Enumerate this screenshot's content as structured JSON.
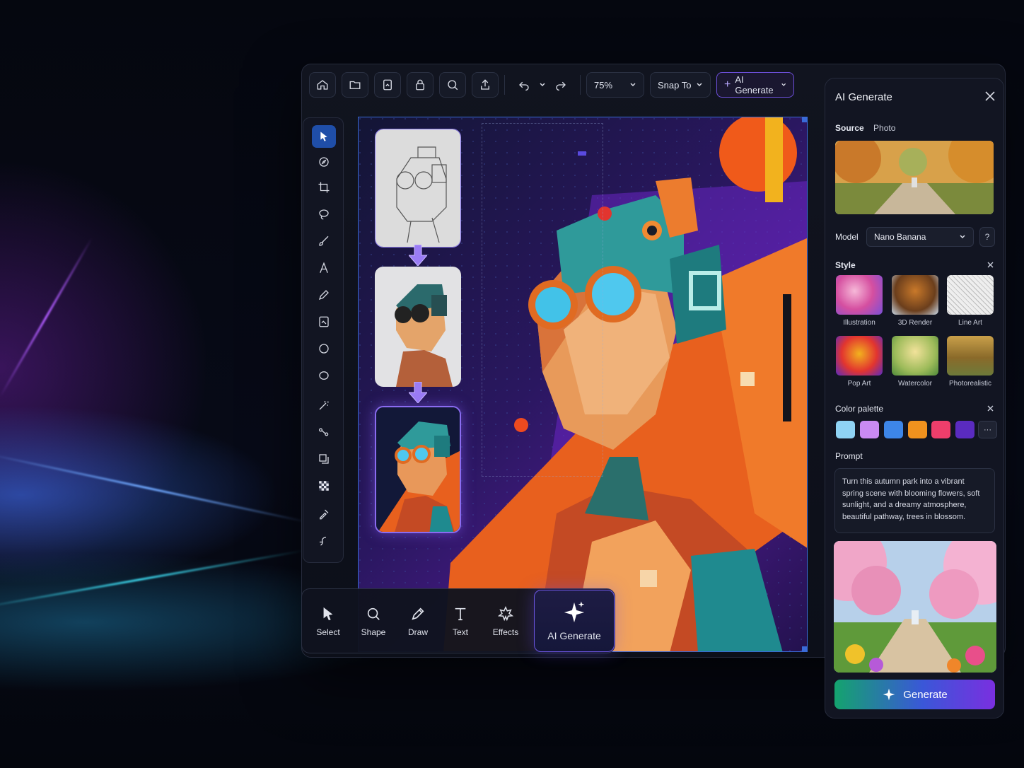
{
  "toolbar": {
    "zoom": "75%",
    "snap": "Snap To",
    "ai_generate": "AI Generate"
  },
  "panel": {
    "title": "AI Generate",
    "source_label": "Source",
    "source_value": "Photo",
    "model_label": "Model",
    "model_value": "Nano Banana",
    "model_help": "?",
    "style_label": "Style",
    "styles": [
      "Illustration",
      "3D Render",
      "Line Art",
      "Pop Art",
      "Watercolor",
      "Photorealistic"
    ],
    "palette_label": "Color palette",
    "palette_colors": [
      "#8fd3f4",
      "#c98af2",
      "#3d86e8",
      "#f0921e",
      "#ee3e6b",
      "#5a2bc0"
    ],
    "palette_more": "···",
    "prompt_label": "Prompt",
    "prompt_text": "Turn this autumn park into a vibrant spring scene with blooming flowers, soft sunlight, and a dreamy atmosphere, beautiful pathway, trees in blossom.",
    "generate": "Generate"
  },
  "bottombar": {
    "select": "Select",
    "shape": "Shape",
    "draw": "Draw",
    "text": "Text",
    "effects": "Effects",
    "ai_generate": "AI Generate"
  },
  "colors": {
    "accent": "#3a6bd8",
    "ai_purple": "#7a2fe0",
    "generate_green": "#14a36e"
  }
}
